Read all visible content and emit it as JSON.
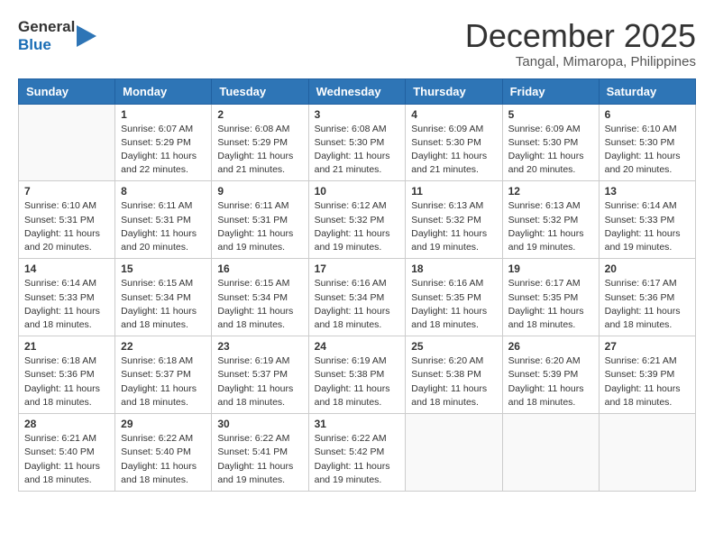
{
  "header": {
    "logo_general": "General",
    "logo_blue": "Blue",
    "month_year": "December 2025",
    "location": "Tangal, Mimaropa, Philippines"
  },
  "days_of_week": [
    "Sunday",
    "Monday",
    "Tuesday",
    "Wednesday",
    "Thursday",
    "Friday",
    "Saturday"
  ],
  "weeks": [
    [
      {
        "day": "",
        "empty": true
      },
      {
        "day": "1",
        "sunrise": "6:07 AM",
        "sunset": "5:29 PM",
        "daylight": "11 hours and 22 minutes."
      },
      {
        "day": "2",
        "sunrise": "6:08 AM",
        "sunset": "5:29 PM",
        "daylight": "11 hours and 21 minutes."
      },
      {
        "day": "3",
        "sunrise": "6:08 AM",
        "sunset": "5:30 PM",
        "daylight": "11 hours and 21 minutes."
      },
      {
        "day": "4",
        "sunrise": "6:09 AM",
        "sunset": "5:30 PM",
        "daylight": "11 hours and 21 minutes."
      },
      {
        "day": "5",
        "sunrise": "6:09 AM",
        "sunset": "5:30 PM",
        "daylight": "11 hours and 20 minutes."
      },
      {
        "day": "6",
        "sunrise": "6:10 AM",
        "sunset": "5:30 PM",
        "daylight": "11 hours and 20 minutes."
      }
    ],
    [
      {
        "day": "7",
        "sunrise": "6:10 AM",
        "sunset": "5:31 PM",
        "daylight": "11 hours and 20 minutes."
      },
      {
        "day": "8",
        "sunrise": "6:11 AM",
        "sunset": "5:31 PM",
        "daylight": "11 hours and 20 minutes."
      },
      {
        "day": "9",
        "sunrise": "6:11 AM",
        "sunset": "5:31 PM",
        "daylight": "11 hours and 19 minutes."
      },
      {
        "day": "10",
        "sunrise": "6:12 AM",
        "sunset": "5:32 PM",
        "daylight": "11 hours and 19 minutes."
      },
      {
        "day": "11",
        "sunrise": "6:13 AM",
        "sunset": "5:32 PM",
        "daylight": "11 hours and 19 minutes."
      },
      {
        "day": "12",
        "sunrise": "6:13 AM",
        "sunset": "5:32 PM",
        "daylight": "11 hours and 19 minutes."
      },
      {
        "day": "13",
        "sunrise": "6:14 AM",
        "sunset": "5:33 PM",
        "daylight": "11 hours and 19 minutes."
      }
    ],
    [
      {
        "day": "14",
        "sunrise": "6:14 AM",
        "sunset": "5:33 PM",
        "daylight": "11 hours and 18 minutes."
      },
      {
        "day": "15",
        "sunrise": "6:15 AM",
        "sunset": "5:34 PM",
        "daylight": "11 hours and 18 minutes."
      },
      {
        "day": "16",
        "sunrise": "6:15 AM",
        "sunset": "5:34 PM",
        "daylight": "11 hours and 18 minutes."
      },
      {
        "day": "17",
        "sunrise": "6:16 AM",
        "sunset": "5:34 PM",
        "daylight": "11 hours and 18 minutes."
      },
      {
        "day": "18",
        "sunrise": "6:16 AM",
        "sunset": "5:35 PM",
        "daylight": "11 hours and 18 minutes."
      },
      {
        "day": "19",
        "sunrise": "6:17 AM",
        "sunset": "5:35 PM",
        "daylight": "11 hours and 18 minutes."
      },
      {
        "day": "20",
        "sunrise": "6:17 AM",
        "sunset": "5:36 PM",
        "daylight": "11 hours and 18 minutes."
      }
    ],
    [
      {
        "day": "21",
        "sunrise": "6:18 AM",
        "sunset": "5:36 PM",
        "daylight": "11 hours and 18 minutes."
      },
      {
        "day": "22",
        "sunrise": "6:18 AM",
        "sunset": "5:37 PM",
        "daylight": "11 hours and 18 minutes."
      },
      {
        "day": "23",
        "sunrise": "6:19 AM",
        "sunset": "5:37 PM",
        "daylight": "11 hours and 18 minutes."
      },
      {
        "day": "24",
        "sunrise": "6:19 AM",
        "sunset": "5:38 PM",
        "daylight": "11 hours and 18 minutes."
      },
      {
        "day": "25",
        "sunrise": "6:20 AM",
        "sunset": "5:38 PM",
        "daylight": "11 hours and 18 minutes."
      },
      {
        "day": "26",
        "sunrise": "6:20 AM",
        "sunset": "5:39 PM",
        "daylight": "11 hours and 18 minutes."
      },
      {
        "day": "27",
        "sunrise": "6:21 AM",
        "sunset": "5:39 PM",
        "daylight": "11 hours and 18 minutes."
      }
    ],
    [
      {
        "day": "28",
        "sunrise": "6:21 AM",
        "sunset": "5:40 PM",
        "daylight": "11 hours and 18 minutes."
      },
      {
        "day": "29",
        "sunrise": "6:22 AM",
        "sunset": "5:40 PM",
        "daylight": "11 hours and 18 minutes."
      },
      {
        "day": "30",
        "sunrise": "6:22 AM",
        "sunset": "5:41 PM",
        "daylight": "11 hours and 19 minutes."
      },
      {
        "day": "31",
        "sunrise": "6:22 AM",
        "sunset": "5:42 PM",
        "daylight": "11 hours and 19 minutes."
      },
      {
        "day": "",
        "empty": true
      },
      {
        "day": "",
        "empty": true
      },
      {
        "day": "",
        "empty": true
      }
    ]
  ]
}
